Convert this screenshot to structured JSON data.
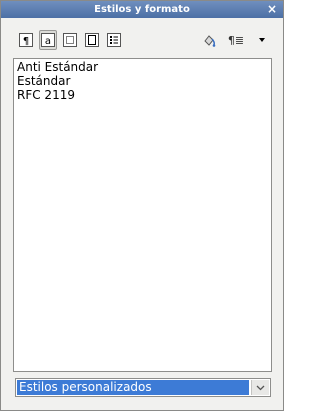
{
  "window": {
    "title": "Estilos y formato"
  },
  "toolbar": {
    "buttons": [
      {
        "icon": "paragraph-styles-icon",
        "active": false
      },
      {
        "icon": "character-styles-icon",
        "active": true
      },
      {
        "icon": "frame-styles-icon",
        "active": false
      },
      {
        "icon": "page-styles-icon",
        "active": false
      },
      {
        "icon": "list-styles-icon",
        "active": false
      },
      {
        "icon": "fill-format-mode-icon",
        "active": false
      },
      {
        "icon": "new-style-from-selection-icon",
        "active": false
      },
      {
        "icon": "dropdown-arrow-icon",
        "active": false
      }
    ],
    "new_style_glyph": "¶≣"
  },
  "styles_list": {
    "items": [
      "Anti Estándar",
      "Estándar",
      "RFC 2119"
    ]
  },
  "filter": {
    "selected": "Estilos personalizados"
  },
  "background_glyph": "C",
  "colors": {
    "titlebar": "#4c6fa5",
    "selection": "#3d7bd6"
  }
}
